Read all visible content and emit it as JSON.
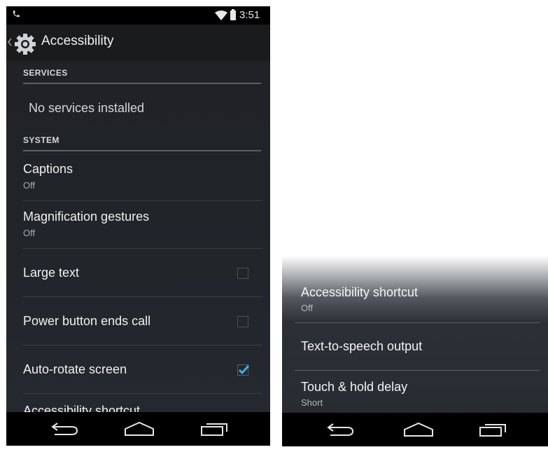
{
  "status_bar": {
    "time": "3:51"
  },
  "action_bar": {
    "title": "Accessibility"
  },
  "sections": {
    "services": {
      "header": "SERVICES",
      "empty_text": "No services installed"
    },
    "system": {
      "header": "SYSTEM"
    }
  },
  "items": {
    "captions": {
      "label": "Captions",
      "summary": "Off"
    },
    "magnification": {
      "label": "Magnification gestures",
      "summary": "Off"
    },
    "large_text": {
      "label": "Large text",
      "checked": false
    },
    "power_button": {
      "label": "Power button ends call",
      "checked": false
    },
    "auto_rotate": {
      "label": "Auto-rotate screen",
      "checked": true
    },
    "accessibility_shortcut": {
      "label": "Accessibility shortcut",
      "summary": "Off"
    },
    "tts_output": {
      "label": "Text-to-speech output"
    },
    "touch_hold": {
      "label": "Touch & hold delay",
      "summary": "Short"
    }
  },
  "colors": {
    "accent_check": "#33b5e5",
    "background": "#212429",
    "action_bar": "#1a1b1d"
  },
  "icons": [
    "phone-icon",
    "wifi-icon",
    "battery-icon",
    "back-caret-icon",
    "gear-icon",
    "check-icon",
    "back-nav-icon",
    "home-nav-icon",
    "recents-nav-icon"
  ]
}
